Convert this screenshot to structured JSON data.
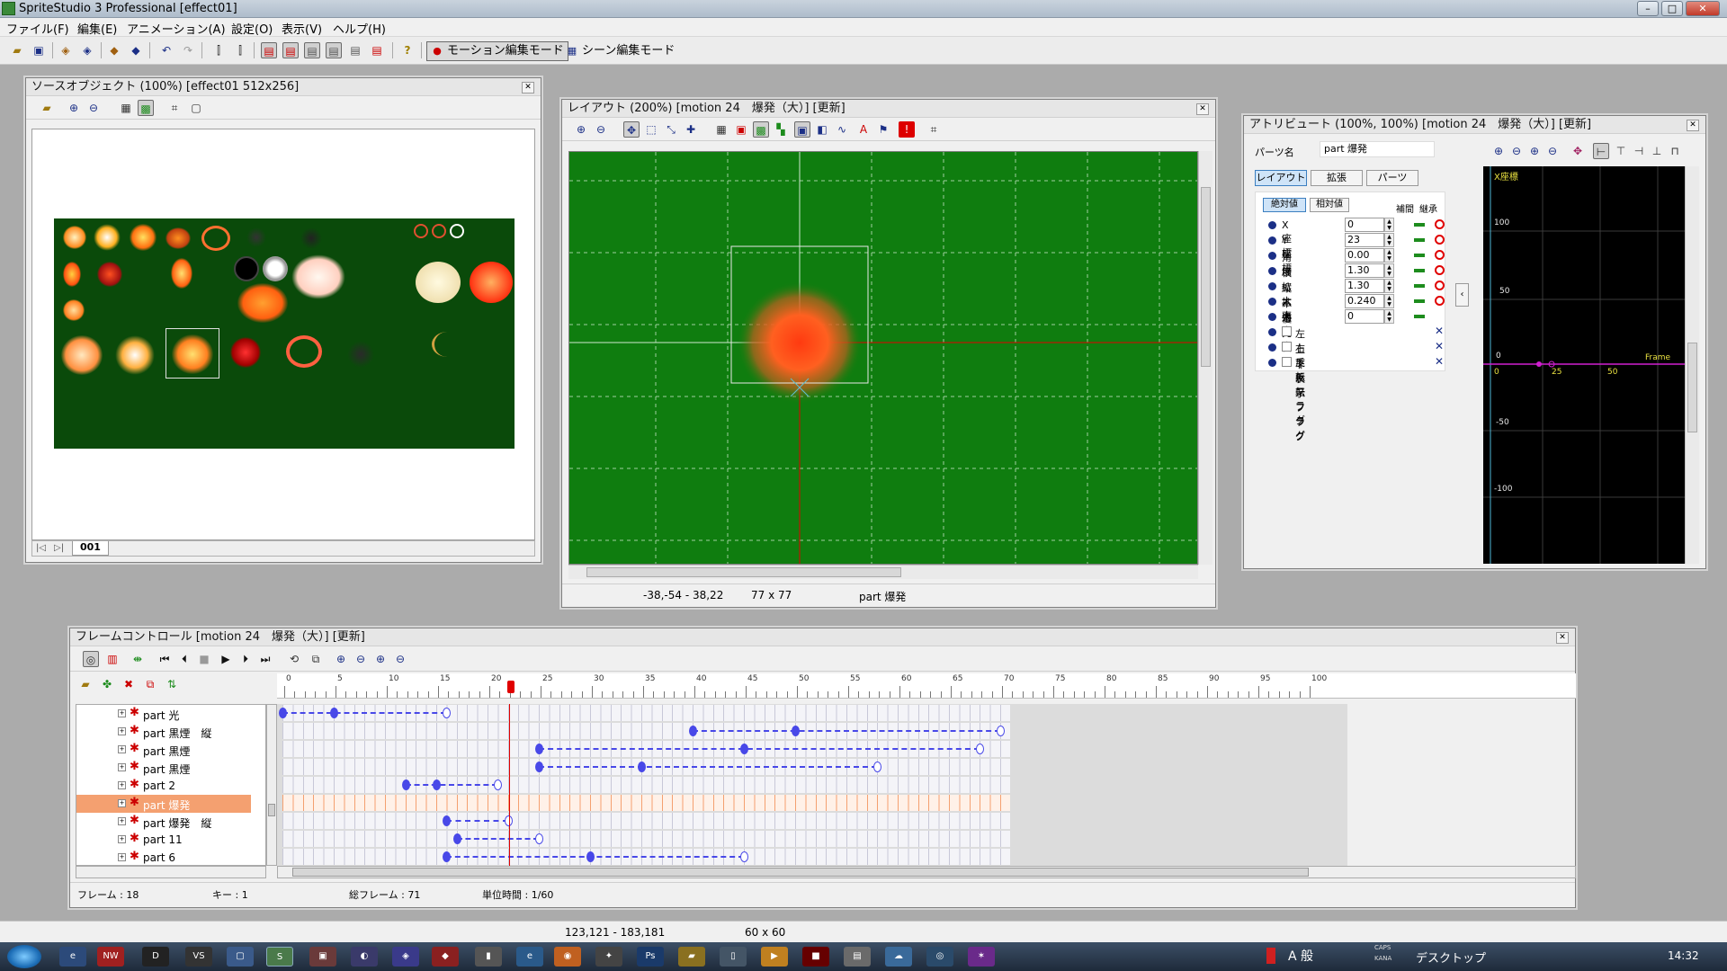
{
  "app": {
    "title": "SpriteStudio 3 Professional [effect01]"
  },
  "menu": [
    "ファイル(F)",
    "編集(E)",
    "アニメーション(A)",
    "設定(O)",
    "表示(V)",
    "ヘルプ(H)"
  ],
  "toolbar": {
    "motion_mode_label": "モーション編集モード",
    "scene_mode_label": "シーン編集モード"
  },
  "source_window": {
    "title": "ソースオブジェクト (100%) [effect01  512x256]",
    "tab": "001"
  },
  "layout_window": {
    "title": "レイアウト (200%) [motion 24　爆発（大）] [更新]",
    "status": {
      "coords": "-38,-54 - 38,22",
      "size": "77 x 77",
      "part": "part 爆発"
    },
    "canvas_color": "#0f7d0f"
  },
  "attribute_window": {
    "title": "アトリビュート (100%, 100%) [motion 24　爆発（大）] [更新]",
    "part_name_label": "パーツ名",
    "part_name_value": "part 爆発",
    "tabs": [
      "レイアウト",
      "拡張",
      "パーツ"
    ],
    "value_modes": [
      "絶対値",
      "相対値"
    ],
    "col_interp": "補間",
    "col_inherit": "継承",
    "attributes": [
      {
        "name": "X座標",
        "value": "0"
      },
      {
        "name": "Y座標",
        "value": "23"
      },
      {
        "name": "角度",
        "value": "0.00"
      },
      {
        "name": "横拡大率",
        "value": "1.30"
      },
      {
        "name": "縦拡大率",
        "value": "1.30"
      },
      {
        "name": "不透明度",
        "value": "0.240"
      },
      {
        "name": "優先度",
        "value": "0"
      }
    ],
    "flags": [
      "左右反転フラグ",
      "上下反転フラグ",
      "非表示フラグ"
    ],
    "graph": {
      "title": "X座標",
      "y_labels": [
        "100",
        "50",
        "0",
        "-50",
        "-100"
      ],
      "x_labels": [
        "0",
        "25",
        "50"
      ],
      "frame_label": "Frame"
    }
  },
  "frame_window": {
    "title": "フレームコントロール [motion 24　爆発（大）] [更新]",
    "ruler": [
      "0",
      "5",
      "10",
      "15",
      "20",
      "25",
      "30",
      "35",
      "40",
      "45",
      "50",
      "55",
      "60",
      "65",
      "70",
      "75",
      "80",
      "85",
      "90",
      "95",
      "100"
    ],
    "current_frame": 18,
    "total_frames": 71,
    "parts": [
      {
        "name": "part 光",
        "keys": [
          0,
          5,
          16
        ],
        "selected": false
      },
      {
        "name": "part 黒煙　縦",
        "keys": [
          40,
          50,
          70
        ],
        "selected": false
      },
      {
        "name": "part 黒煙",
        "keys": [
          25,
          45,
          68
        ],
        "selected": false
      },
      {
        "name": "part 黒煙",
        "keys": [
          25,
          35,
          58
        ],
        "selected": false
      },
      {
        "name": "part 2",
        "keys": [
          12,
          15,
          21
        ],
        "selected": false
      },
      {
        "name": "part 爆発",
        "keys": [],
        "selected": true
      },
      {
        "name": "part 爆発　縦",
        "keys": [
          16,
          22
        ],
        "selected": false
      },
      {
        "name": "part 11",
        "keys": [
          17,
          25
        ],
        "selected": false
      },
      {
        "name": "part 6",
        "keys": [
          16,
          30,
          45
        ],
        "selected": false
      }
    ],
    "status": {
      "frame": "フレーム : 18",
      "key": "キー : 1",
      "total": "総フレーム : 71",
      "unit": "単位時間 : 1/60"
    }
  },
  "statusbar": {
    "coords": "123,121 - 183,181",
    "size": "60 x 60"
  },
  "taskbar": {
    "desktop_label": "デスクトップ",
    "ime": "A 般",
    "caps": "CAPS",
    "kana": "KANA",
    "clock": "14:32"
  },
  "colors": {
    "canvas_green": "#0f7d0f",
    "sprite_sheet": "#0a4a0a",
    "key_blue": "#4848e8",
    "selected_row": "#f4a070",
    "playhead": "#e00000"
  }
}
